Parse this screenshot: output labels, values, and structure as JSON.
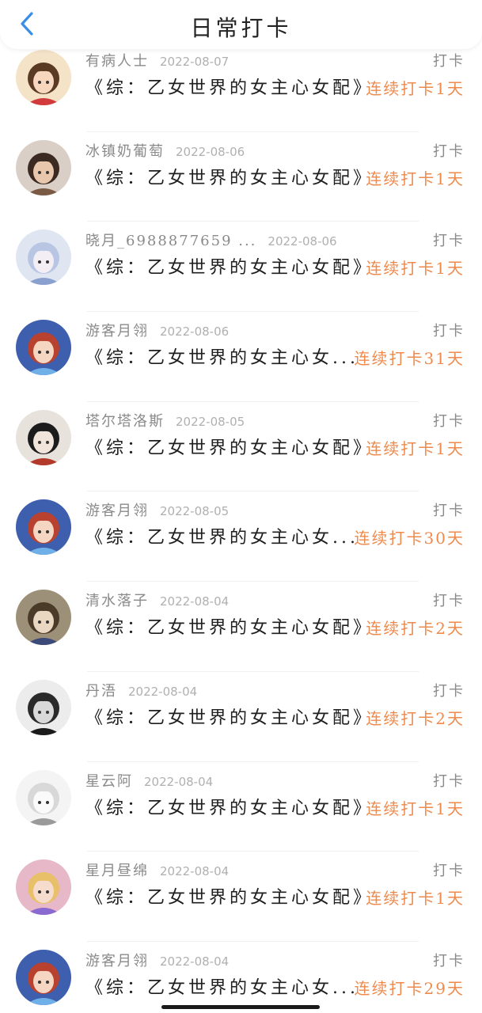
{
  "header": {
    "title": "日常打卡",
    "back_icon": "chevron-left-icon",
    "accent": "#3a8ee6"
  },
  "colors": {
    "streak": "#ee8a4c",
    "meta": "#8a8a8a",
    "date": "#b0b0b0"
  },
  "rows": [
    {
      "user": "有病人士",
      "date": "2022-08-07",
      "action": "打卡",
      "book": "《综：乙女世界的女主心女配》",
      "streak": "连续打卡1天",
      "avatar": "avatar-1"
    },
    {
      "user": "冰镇奶葡萄",
      "date": "2022-08-06",
      "action": "打卡",
      "book": "《综：乙女世界的女主心女配》",
      "streak": "连续打卡1天",
      "avatar": "avatar-2"
    },
    {
      "user": "晓月_6988877659 ...",
      "date": "2022-08-06",
      "action": "打卡",
      "book": "《综：乙女世界的女主心女配》",
      "streak": "连续打卡1天",
      "avatar": "avatar-3"
    },
    {
      "user": "游客月翎",
      "date": "2022-08-06",
      "action": "打卡",
      "book": "《综：乙女世界的女主心女...",
      "streak": "连续打卡31天",
      "avatar": "avatar-4"
    },
    {
      "user": "塔尔塔洛斯",
      "date": "2022-08-05",
      "action": "打卡",
      "book": "《综：乙女世界的女主心女配》",
      "streak": "连续打卡1天",
      "avatar": "avatar-5"
    },
    {
      "user": "游客月翎",
      "date": "2022-08-05",
      "action": "打卡",
      "book": "《综：乙女世界的女主心女...",
      "streak": "连续打卡30天",
      "avatar": "avatar-4"
    },
    {
      "user": "清水落子",
      "date": "2022-08-04",
      "action": "打卡",
      "book": "《综：乙女世界的女主心女配》",
      "streak": "连续打卡2天",
      "avatar": "avatar-6"
    },
    {
      "user": "丹浯",
      "date": "2022-08-04",
      "action": "打卡",
      "book": "《综：乙女世界的女主心女配》",
      "streak": "连续打卡2天",
      "avatar": "avatar-7"
    },
    {
      "user": "星云阿",
      "date": "2022-08-04",
      "action": "打卡",
      "book": "《综：乙女世界的女主心女配》",
      "streak": "连续打卡1天",
      "avatar": "avatar-8"
    },
    {
      "user": "星月昼绵",
      "date": "2022-08-04",
      "action": "打卡",
      "book": "《综：乙女世界的女主心女配》",
      "streak": "连续打卡1天",
      "avatar": "avatar-9"
    },
    {
      "user": "游客月翎",
      "date": "2022-08-04",
      "action": "打卡",
      "book": "《综：乙女世界的女主心女...",
      "streak": "连续打卡29天",
      "avatar": "avatar-4"
    }
  ]
}
